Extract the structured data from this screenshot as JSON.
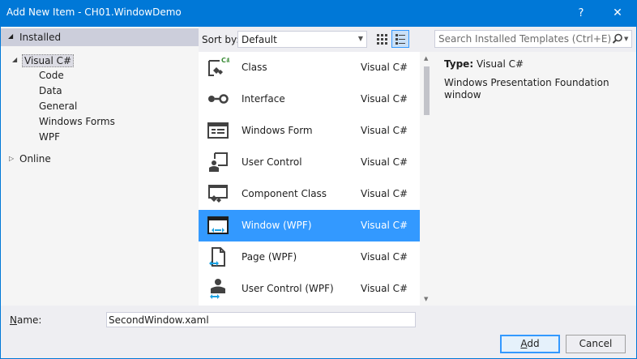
{
  "window": {
    "title": "Add New Item - CH01.WindowDemo",
    "help_label": "?",
    "close_label": "✕"
  },
  "sidebar": {
    "installed_label": "Installed",
    "tree": [
      {
        "label": "Visual C#"
      },
      {
        "label": "Code"
      },
      {
        "label": "Data"
      },
      {
        "label": "General"
      },
      {
        "label": "Windows Forms"
      },
      {
        "label": "WPF"
      }
    ],
    "online_label": "Online"
  },
  "toolbar": {
    "sort_label": "Sort by:",
    "sort_value": "Default",
    "search_placeholder": "Search Installed Templates (Ctrl+E)"
  },
  "templates": [
    {
      "name": "Class",
      "lang": "Visual C#",
      "icon": "class-icon"
    },
    {
      "name": "Interface",
      "lang": "Visual C#",
      "icon": "interface-icon"
    },
    {
      "name": "Windows Form",
      "lang": "Visual C#",
      "icon": "windows-form-icon"
    },
    {
      "name": "User Control",
      "lang": "Visual C#",
      "icon": "user-control-icon"
    },
    {
      "name": "Component Class",
      "lang": "Visual C#",
      "icon": "component-class-icon"
    },
    {
      "name": "Window (WPF)",
      "lang": "Visual C#",
      "icon": "window-wpf-icon",
      "selected": true
    },
    {
      "name": "Page (WPF)",
      "lang": "Visual C#",
      "icon": "page-wpf-icon"
    },
    {
      "name": "User Control (WPF)",
      "lang": "Visual C#",
      "icon": "user-control-wpf-icon"
    }
  ],
  "details": {
    "type_label": "Type:",
    "type_value": "Visual C#",
    "description": "Windows Presentation Foundation window"
  },
  "footer": {
    "name_label": "Name:",
    "name_value": "SecondWindow.xaml",
    "add_label": "Add",
    "cancel_label": "Cancel"
  },
  "colors": {
    "titlebar": "#0078d7",
    "selection": "#3399ff",
    "accent_blue": "#1ba1e2"
  }
}
